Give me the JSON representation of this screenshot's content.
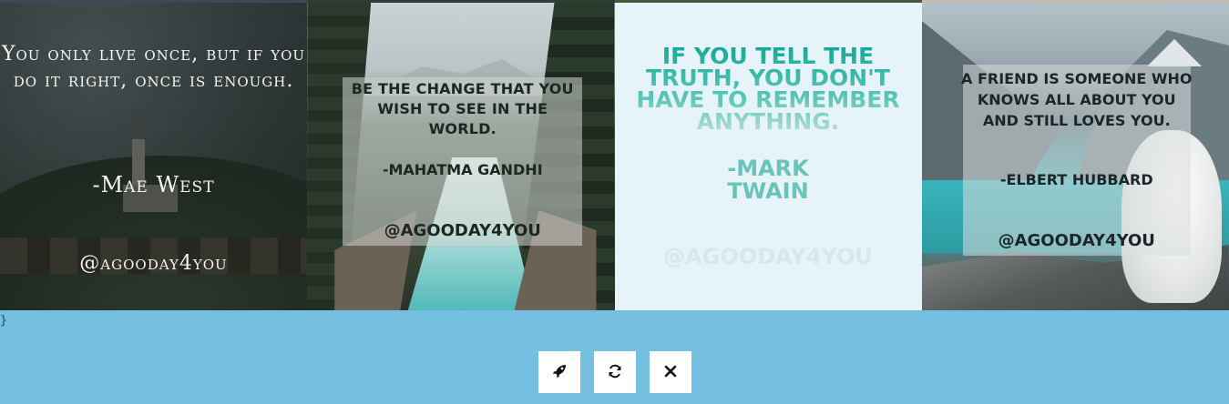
{
  "cards": [
    {
      "quote": "You only live once, but if you do it right, once is enough.",
      "author": "-Mae West",
      "handle": "@agooday4you"
    },
    {
      "quote": "Be the change that you wish to see in the world.",
      "author": "-Mahatma Gandhi",
      "handle": "@agooday4you"
    },
    {
      "quote": "If you tell the truth, you don't have to remember anything.",
      "author": "-Mark Twain",
      "handle": "@agooday4you"
    },
    {
      "quote": "A friend is someone who knows all about you and still loves you.",
      "author": "-Elbert Hubbard",
      "handle": "@agooday4you"
    }
  ],
  "stray_text": "}",
  "toolbar": {
    "buttons": [
      {
        "icon": "rocket-icon"
      },
      {
        "icon": "refresh-icon"
      },
      {
        "icon": "close-icon"
      }
    ]
  },
  "colors": {
    "background": "#75c0e0",
    "card3_bg": "#e6f3f9",
    "card3_quote": "#14a896",
    "button_bg": "#ffffff"
  }
}
